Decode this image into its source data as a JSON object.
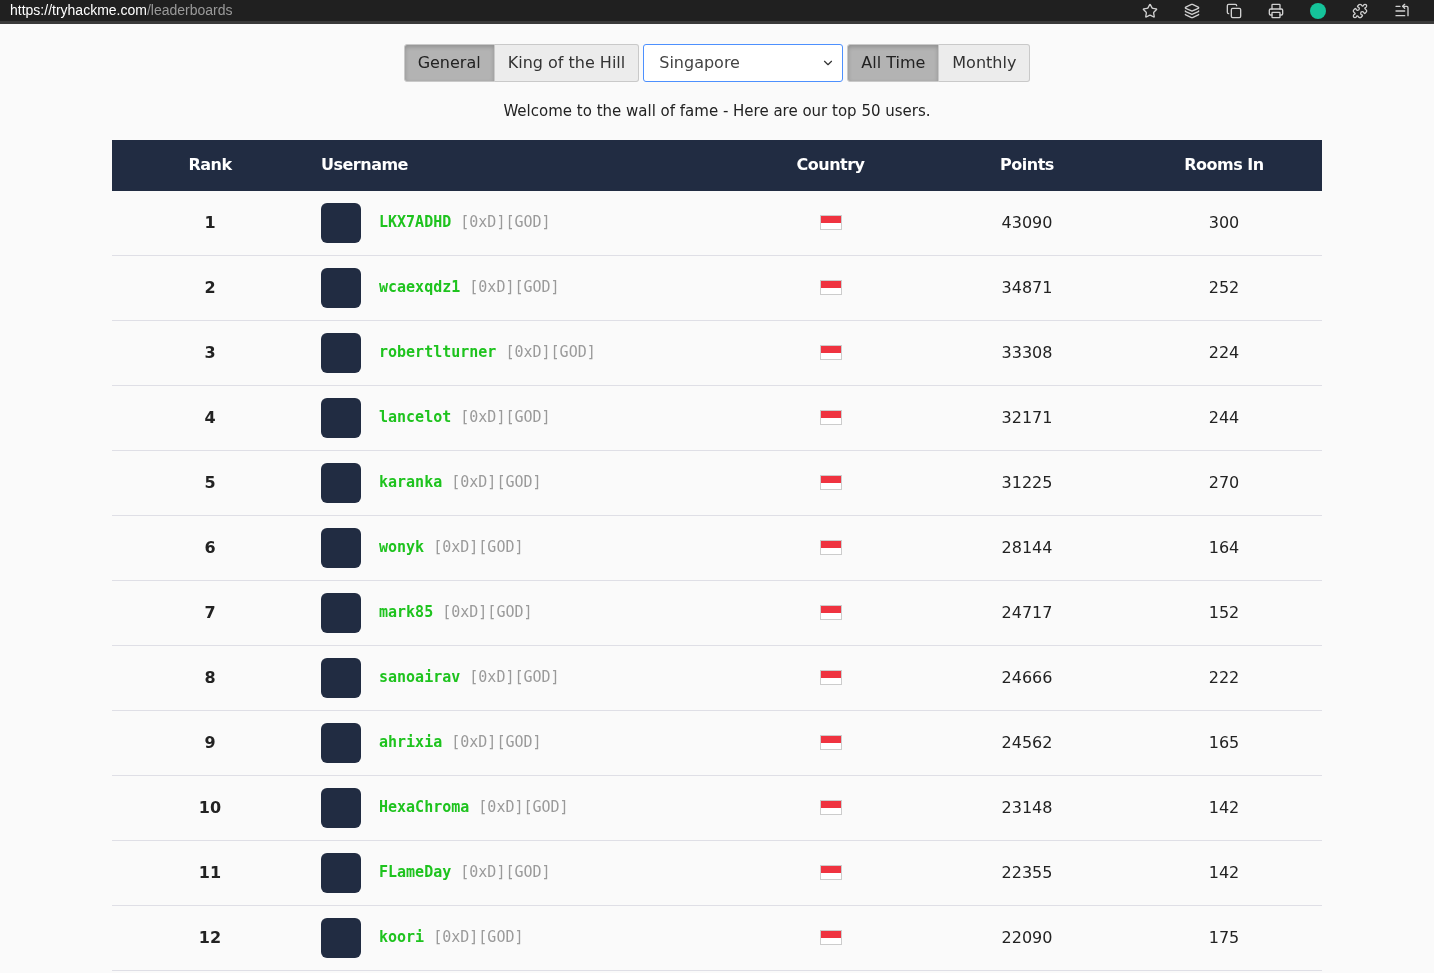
{
  "browser": {
    "url_scheme": "https://",
    "url_host": "tryhackme.com",
    "url_path": "/leaderboards"
  },
  "filters": {
    "categories": [
      {
        "label": "General",
        "selected": true
      },
      {
        "label": "King of the Hill",
        "selected": false
      }
    ],
    "country_select": {
      "value": "Singapore"
    },
    "periods": [
      {
        "label": "All Time",
        "selected": true
      },
      {
        "label": "Monthly",
        "selected": false
      }
    ]
  },
  "intro": "Welcome to the wall of fame - Here are our top 50 users.",
  "table": {
    "columns": [
      "Rank",
      "Username",
      "Country",
      "Points",
      "Rooms In"
    ],
    "rows": [
      {
        "rank": "1",
        "username": "LKX7ADHD",
        "tag": "[0xD][GOD]",
        "points": "43090",
        "rooms": "300"
      },
      {
        "rank": "2",
        "username": "wcaexqdz1",
        "tag": "[0xD][GOD]",
        "points": "34871",
        "rooms": "252"
      },
      {
        "rank": "3",
        "username": "robertlturner",
        "tag": "[0xD][GOD]",
        "points": "33308",
        "rooms": "224"
      },
      {
        "rank": "4",
        "username": "lancelot",
        "tag": "[0xD][GOD]",
        "points": "32171",
        "rooms": "244"
      },
      {
        "rank": "5",
        "username": "karanka",
        "tag": "[0xD][GOD]",
        "points": "31225",
        "rooms": "270"
      },
      {
        "rank": "6",
        "username": "wonyk",
        "tag": "[0xD][GOD]",
        "points": "28144",
        "rooms": "164"
      },
      {
        "rank": "7",
        "username": "mark85",
        "tag": "[0xD][GOD]",
        "points": "24717",
        "rooms": "152"
      },
      {
        "rank": "8",
        "username": "sanoairav",
        "tag": "[0xD][GOD]",
        "points": "24666",
        "rooms": "222"
      },
      {
        "rank": "9",
        "username": "ahrixia",
        "tag": "[0xD][GOD]",
        "points": "24562",
        "rooms": "165"
      },
      {
        "rank": "10",
        "username": "HexaChroma",
        "tag": "[0xD][GOD]",
        "points": "23148",
        "rooms": "142"
      },
      {
        "rank": "11",
        "username": "FLameDay",
        "tag": "[0xD][GOD]",
        "points": "22355",
        "rooms": "142"
      },
      {
        "rank": "12",
        "username": "koori",
        "tag": "[0xD][GOD]",
        "points": "22090",
        "rooms": "175"
      }
    ]
  }
}
